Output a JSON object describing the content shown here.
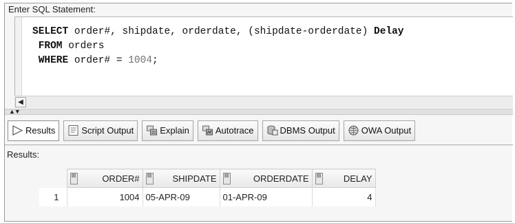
{
  "editor": {
    "label": "Enter SQL Statement:",
    "lines": [
      {
        "kw": "SELECT",
        "rest": " order#, shipdate, orderdate, (shipdate-orderdate) ",
        "kw2": "Delay"
      },
      {
        "kw": " FROM",
        "rest": " orders"
      },
      {
        "kw": " WHERE",
        "rest": " order# = ",
        "num": "1004",
        "end": ";"
      }
    ]
  },
  "tabs": [
    {
      "label": "Results",
      "icon": "play-arrow-icon",
      "active": true
    },
    {
      "label": "Script Output",
      "icon": "script-output-icon"
    },
    {
      "label": "Explain",
      "icon": "explain-plan-icon"
    },
    {
      "label": "Autotrace",
      "icon": "autotrace-icon"
    },
    {
      "label": "DBMS Output",
      "icon": "dbms-output-icon"
    },
    {
      "label": "OWA Output",
      "icon": "owa-output-icon"
    }
  ],
  "results": {
    "label": "Results:",
    "columns": [
      "ORDER#",
      "SHIPDATE",
      "ORDERDATE",
      "DELAY"
    ],
    "rows": [
      {
        "num": "1",
        "cells": [
          "1004",
          "05-APR-09",
          "01-APR-09",
          "4"
        ]
      }
    ]
  },
  "colors": {
    "frame_border": "#9a9a9a",
    "panel_bg": "#f6f6f6",
    "editor_bg": "#ffffff",
    "number_literal": "#707070"
  }
}
